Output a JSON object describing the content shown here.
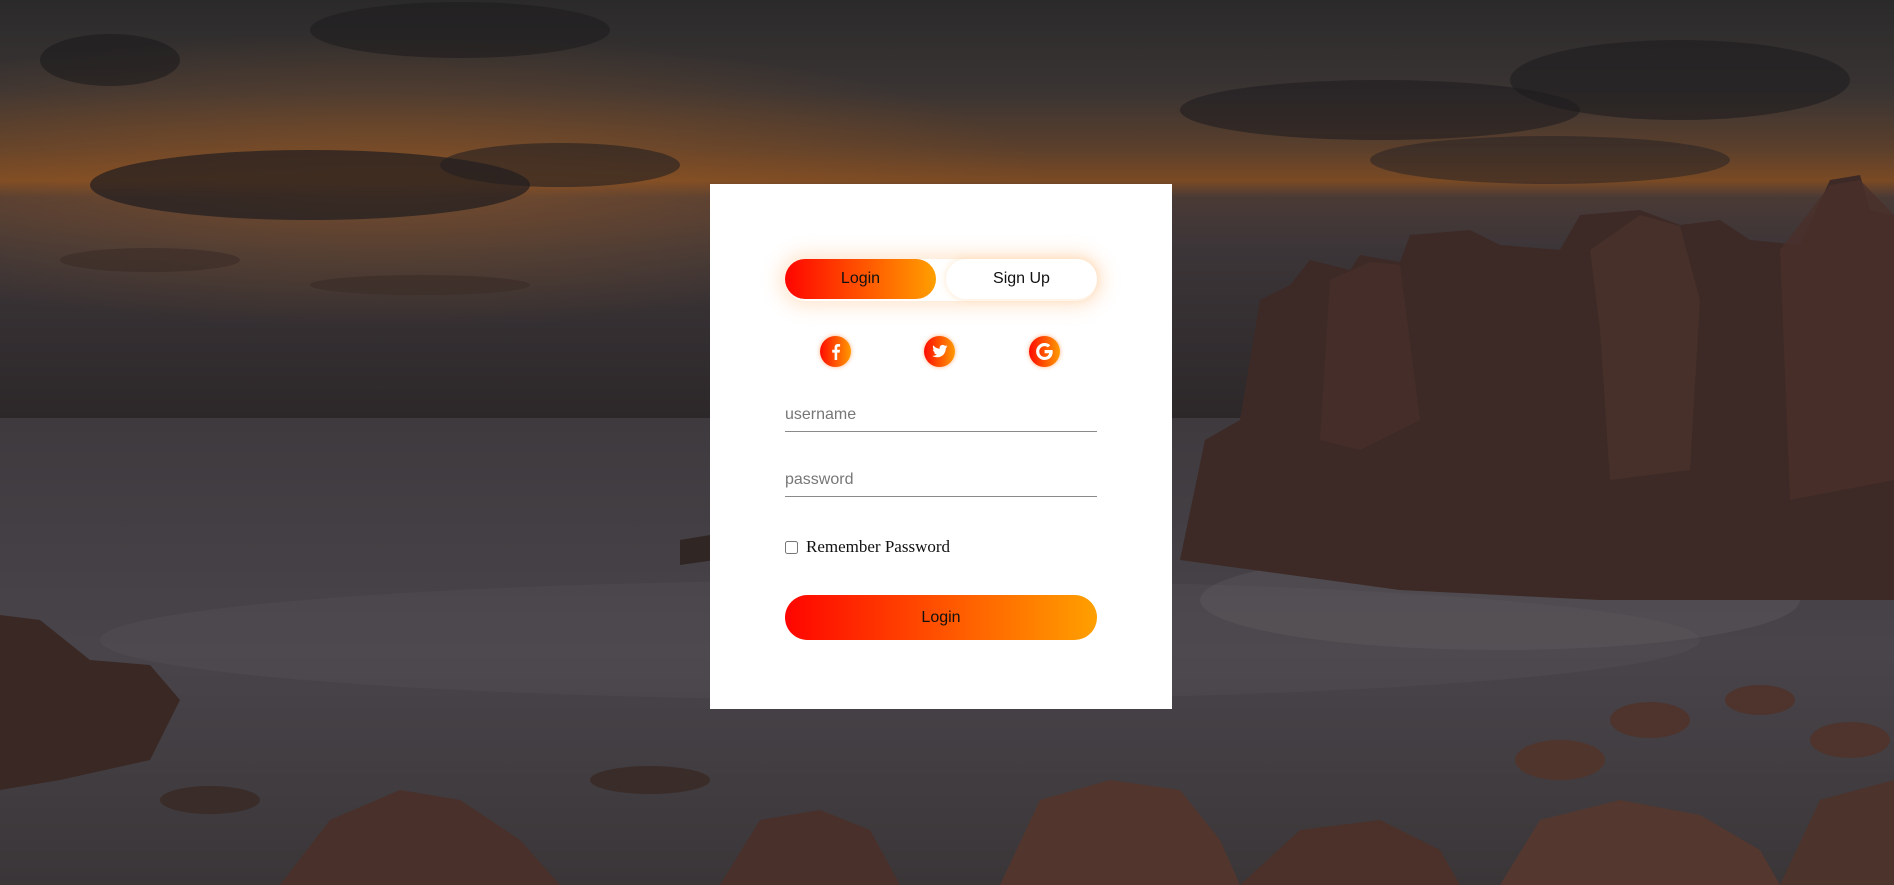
{
  "tabs": {
    "login_label": "Login",
    "signup_label": "Sign Up"
  },
  "social": {
    "icons": [
      "facebook-icon",
      "twitter-icon",
      "google-icon"
    ]
  },
  "form": {
    "username_placeholder": "username",
    "password_placeholder": "password",
    "username_value": "",
    "password_value": "",
    "remember_label": "Remember Password",
    "remember_checked": false,
    "submit_label": "Login"
  },
  "colors": {
    "gradient_start": "#ff0500",
    "gradient_end": "#ffa000",
    "card": "#ffffff"
  }
}
